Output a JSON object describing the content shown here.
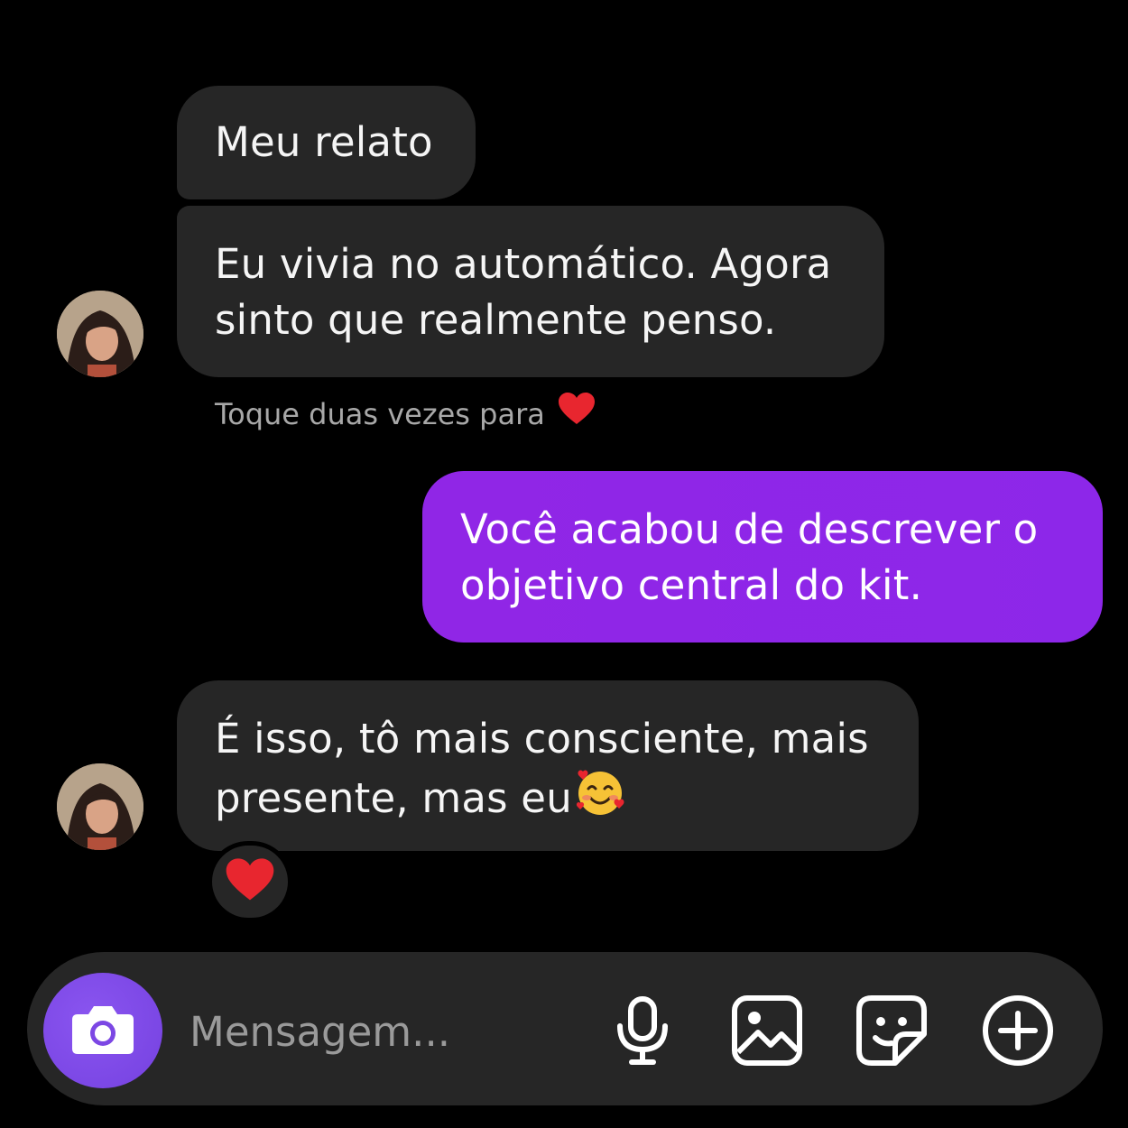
{
  "messages": [
    {
      "id": "b1",
      "direction": "incoming",
      "text": "Meu relato"
    },
    {
      "id": "b2",
      "direction": "incoming",
      "text": "Eu vivia no automático. Agora sinto que realmente penso."
    },
    {
      "id": "b3",
      "direction": "outgoing",
      "text": "Você acabou de descrever o objetivo central do kit."
    },
    {
      "id": "b4",
      "direction": "incoming",
      "text": "É isso, tô mais consciente, mais presente, mas eu",
      "emoji": "smiling-face-with-hearts"
    }
  ],
  "hint": {
    "text": "Toque duas vezes para",
    "icon": "heart-icon"
  },
  "reaction": {
    "icon": "heart-icon"
  },
  "composer": {
    "placeholder": "Mensagem...",
    "camera_icon": "camera-icon",
    "tools": [
      "microphone-icon",
      "gallery-icon",
      "sticker-icon",
      "plus-circle-icon"
    ]
  },
  "colors": {
    "background": "#000000",
    "incoming_bubble": "#262626",
    "outgoing_bubble": "#8e25e7",
    "camera_button": "#7f4be6",
    "heart": "#e8262f",
    "hint_text": "#a8a8a8"
  }
}
